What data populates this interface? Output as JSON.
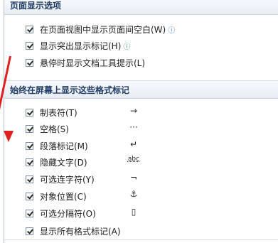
{
  "sections": {
    "page_display": {
      "title": "页面显示选项",
      "items": [
        {
          "label": "在页面视图中显示页面间空白(W)",
          "checked": true,
          "info_icon": "info-icon"
        },
        {
          "label": "显示突出显示标记(H)",
          "checked": true,
          "info_icon": "info-icon"
        },
        {
          "label": "悬停时显示文档工具提示(L)",
          "checked": true
        }
      ]
    },
    "format_marks": {
      "title": "始终在屏幕上显示这些格式标记",
      "items": [
        {
          "label": "制表符(T)",
          "mark": "→",
          "checked": true
        },
        {
          "label": "空格(S)",
          "mark": "···",
          "checked": true
        },
        {
          "label": "段落标记(M)",
          "mark": "↵",
          "checked": true
        },
        {
          "label": "隐藏文字(D)",
          "mark": "abc",
          "checked": true
        },
        {
          "label": "可选连字符(Y)",
          "mark": "¬",
          "checked": true
        },
        {
          "label": "对象位置(C)",
          "mark": "⚓",
          "checked": true
        },
        {
          "label": "可选分隔符(O)",
          "mark": "▯",
          "checked": true
        },
        {
          "label": "显示所有格式标记(A)",
          "checked": true
        }
      ]
    }
  },
  "annotation": {
    "color": "#e02020",
    "icon": "red-arrow-annotation"
  }
}
